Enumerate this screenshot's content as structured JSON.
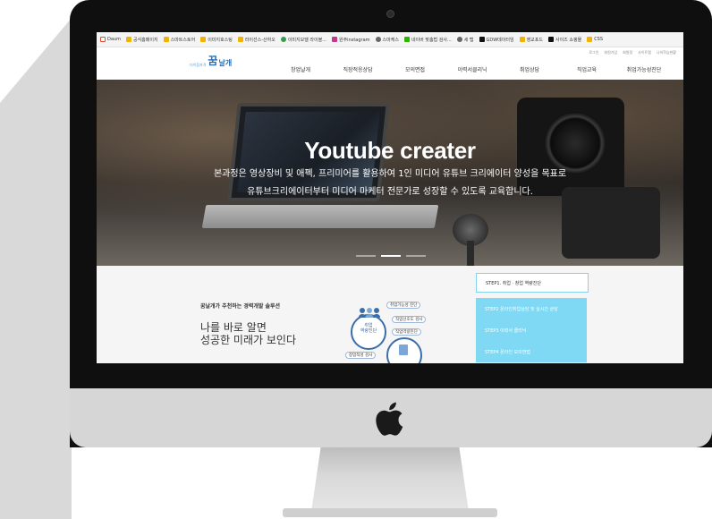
{
  "bookmarks": [
    {
      "label": "Daum",
      "icon": "daum-icon"
    },
    {
      "label": "공식홈페이지",
      "icon": "bookmark-icon"
    },
    {
      "label": "스마트스토어",
      "icon": "bookmark-icon"
    },
    {
      "label": "이미지호스팅",
      "icon": "bookmark-icon"
    },
    {
      "label": "라이선스-산하오",
      "icon": "bookmark-icon"
    },
    {
      "label": "이미지모델 라이블...",
      "icon": "globe-icon"
    },
    {
      "label": "원주instagram",
      "icon": "instagram-icon"
    },
    {
      "label": "스마케스",
      "icon": "globe-icon"
    },
    {
      "label": "네이버 맞춤법 검사...",
      "icon": "naver-icon"
    },
    {
      "label": "세 탭",
      "icon": "globe-icon"
    },
    {
      "label": "GDW데이터임",
      "icon": "tiktok-icon"
    },
    {
      "label": "영교포드",
      "icon": "bookmark-icon"
    },
    {
      "label": "사이즈 쇼핑몰",
      "icon": "bookmark-icon"
    },
    {
      "label": "CSS",
      "icon": "bookmark-icon"
    }
  ],
  "header": {
    "util_links": [
      "로그인",
      "회원가입",
      "회원정",
      "사이트맵",
      "나의학습현황"
    ],
    "logo_sub": "더이음자격",
    "logo_main": "꿈",
    "logo_main2": "날개",
    "nav": [
      "창업날개",
      "직장적응상담",
      "모의면접",
      "이력서클리닉",
      "취업상담",
      "직업교육",
      "취업가능성진단"
    ]
  },
  "hero": {
    "title": "Youtube creater",
    "desc_line1": "본과정은 영상장비 및 애펙, 프리미어를 활용하여 1인 미디어 유튜브 크리에이터 양성을 목표로",
    "desc_line2": "유튜브크리에이터부터 미디어 마케터 전문가로 성장할 수 있도록 교육합니다.",
    "slide_count": 3,
    "active_slide": 2
  },
  "lower": {
    "tag": "꿈날개가 추천하는 경력개발 솔루션",
    "slogan_line1": "나를 바로 알면",
    "slogan_line2": "성공한 미래가 보인다",
    "diagram": {
      "center_line1": "취업",
      "center_line2": "역량진단",
      "labels": [
        "취업가능성 진단",
        "직업선호도 검사",
        "직업역량진단",
        "창업적성 검사"
      ]
    },
    "steps": [
      {
        "label": "STEP1. 취업 · 창업 역량진단",
        "active": true
      },
      {
        "label": "STEP2 온라인취업상담 및 실시간 상담",
        "active": false
      },
      {
        "label": "STEP3 이력서 클리닉",
        "active": false
      },
      {
        "label": "STEP4 온라인 모의면접",
        "active": false
      }
    ]
  },
  "colors": {
    "step_active_border": "#7fd4f0",
    "step_inactive_bg": "#7fd9f4",
    "brand_blue": "#2b6cb0",
    "monitor_bezel": "#0f0f0f",
    "monitor_chin": "#d6d6d6"
  }
}
